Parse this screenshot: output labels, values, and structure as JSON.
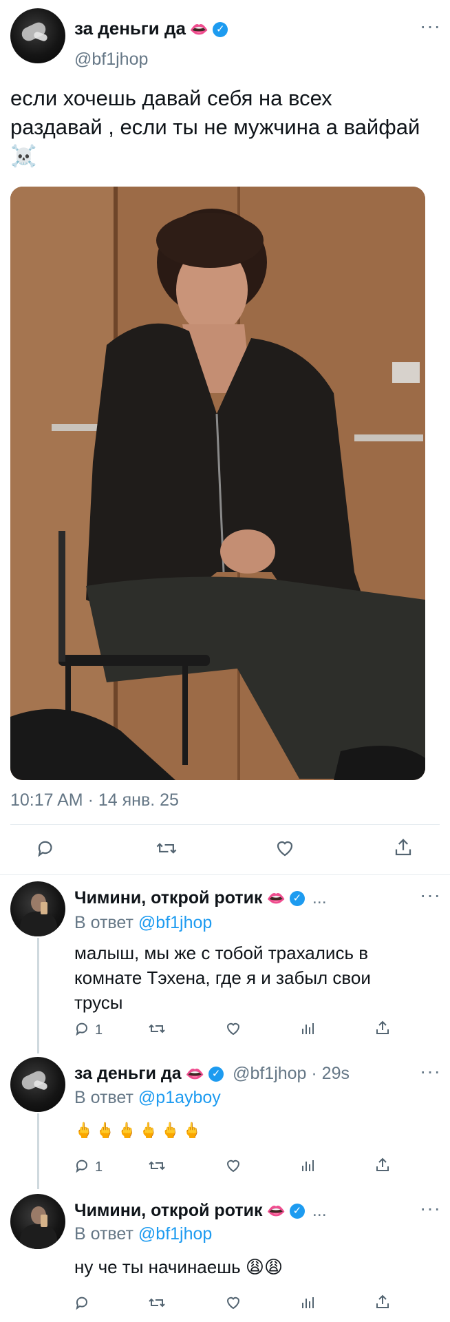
{
  "tweet": {
    "author_name": "за деньги да",
    "author_emoji": "👄",
    "handle": "@bf1jhop",
    "text": "если хочешь давай себя на всех раздавай , если ты не мужчина а вайфай ☠️",
    "timestamp": "10:17 AM · 14 янв. 25",
    "more_icon": "more-horizontal-icon",
    "actions": [
      "reply-icon",
      "retweet-icon",
      "like-icon",
      "share-icon"
    ]
  },
  "replies": [
    {
      "author_name": "Чимини, открой ротик",
      "author_emoji": "👄",
      "ellipsis": "...",
      "reply_to_label": "В ответ",
      "reply_to_handle": "@bf1jhop",
      "text": "малыш, мы же с тобой трахались в комнате Тэхена, где я и забыл свои трусы",
      "reply_count": "1"
    },
    {
      "author_name": "за деньги да",
      "author_emoji": "👄",
      "handle_time": "@bf1jhop · 29s",
      "reply_to_label": "В ответ",
      "reply_to_handle": "@p1ayboy",
      "text": "🖕🖕🖕🖕🖕🖕",
      "reply_count": "1"
    },
    {
      "author_name": "Чимини, открой ротик",
      "author_emoji": "👄",
      "ellipsis": "...",
      "reply_to_label": "В ответ",
      "reply_to_handle": "@bf1jhop",
      "text": "ну че ты начинаешь 😩😩"
    }
  ],
  "colors": {
    "accent": "#1d9bf0",
    "secondary_text": "#657786",
    "divider": "#e6ecf0"
  }
}
